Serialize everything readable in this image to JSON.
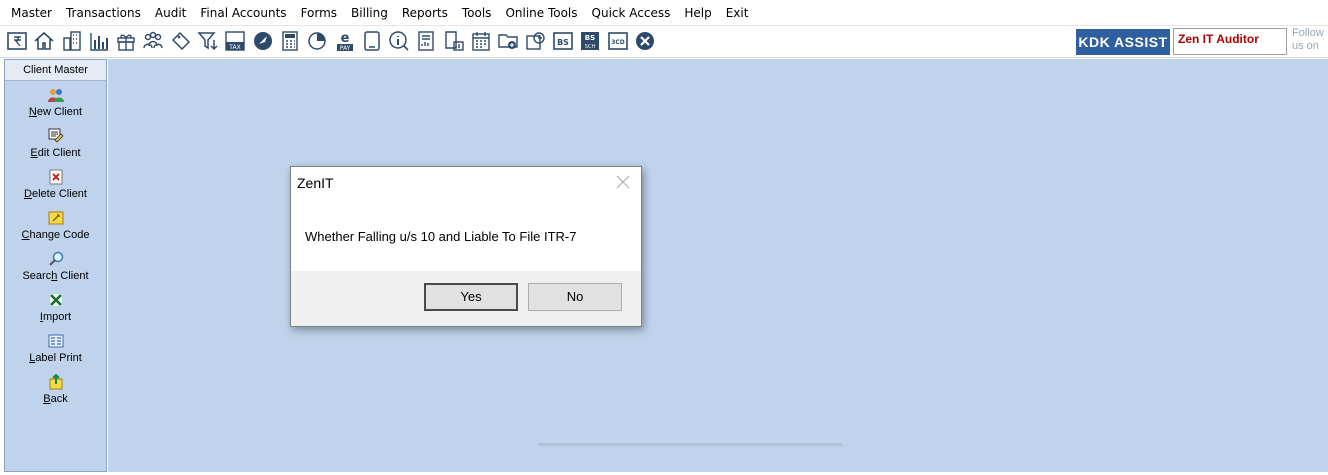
{
  "menu": [
    "Master",
    "Transactions",
    "Audit",
    "Final Accounts",
    "Forms",
    "Billing",
    "Reports",
    "Tools",
    "Online Tools",
    "Quick Access",
    "Help",
    "Exit"
  ],
  "toolbar": {
    "icons": [
      "rupee-book-icon",
      "home-icon",
      "building-icon",
      "bar-chart-icon",
      "gift-icon",
      "users-icon",
      "tag-icon",
      "filter-icon",
      "tax-icon",
      "rocket-icon",
      "calculator-icon",
      "pie-chart-icon",
      "epay-icon",
      "tablet-icon",
      "info-icon",
      "report-icon",
      "document-chart-icon",
      "calendar-icon",
      "folder-add-icon",
      "refresh-icon",
      "bs-icon",
      "bs-sch-icon",
      "3cd-icon",
      "close-circle-icon"
    ],
    "kdk_assist": "KDK ASSIST",
    "auditor": "Zen IT Auditor",
    "follow_line1": "Follow",
    "follow_line2": "us on"
  },
  "sidebar": {
    "title": "Client Master",
    "items": [
      {
        "pre": "",
        "ul": "N",
        "post": "ew Client",
        "icon": "users-icon"
      },
      {
        "pre": "",
        "ul": "E",
        "post": "dit Client",
        "icon": "edit-icon"
      },
      {
        "pre": "",
        "ul": "D",
        "post": "elete Client",
        "icon": "delete-icon"
      },
      {
        "pre": "",
        "ul": "C",
        "post": "hange Code",
        "icon": "change-code-icon"
      },
      {
        "pre": "Searc",
        "ul": "h",
        "post": " Client",
        "icon": "search-icon"
      },
      {
        "pre": "",
        "ul": "I",
        "post": "mport",
        "icon": "excel-import-icon"
      },
      {
        "pre": "",
        "ul": "L",
        "post": "abel Print",
        "icon": "label-print-icon"
      },
      {
        "pre": "",
        "ul": "B",
        "post": "ack",
        "icon": "back-icon"
      }
    ]
  },
  "dialog": {
    "title": "ZenIT",
    "message": "Whether Falling u/s 10 and Liable To File ITR-7",
    "yes": "Yes",
    "no": "No"
  },
  "colors": {
    "workspace": "#bfd3ec",
    "kdk": "#2f5f9e",
    "auditor_text": "#b00000"
  }
}
